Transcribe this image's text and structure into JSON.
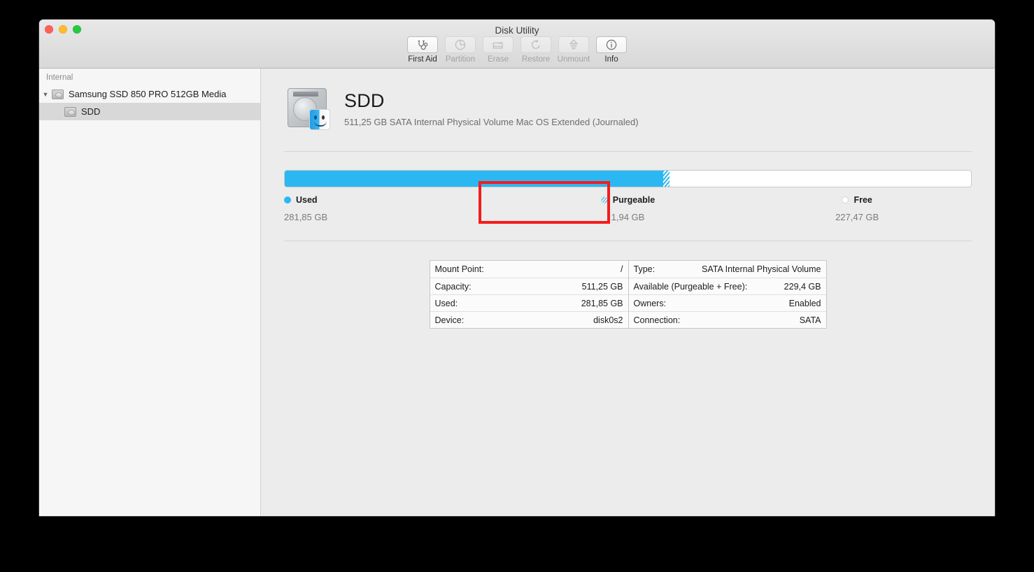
{
  "window": {
    "title": "Disk Utility",
    "traffic_lights": [
      "close",
      "minimize",
      "zoom"
    ]
  },
  "toolbar": {
    "items": [
      {
        "label": "First Aid",
        "icon": "stethoscope-icon",
        "enabled": true
      },
      {
        "label": "Partition",
        "icon": "pie-chart-icon",
        "enabled": false
      },
      {
        "label": "Erase",
        "icon": "erase-icon",
        "enabled": false
      },
      {
        "label": "Restore",
        "icon": "restore-arrow-icon",
        "enabled": false
      },
      {
        "label": "Unmount",
        "icon": "eject-icon",
        "enabled": false
      },
      {
        "label": "Info",
        "icon": "info-circle-icon",
        "enabled": true
      }
    ]
  },
  "sidebar": {
    "header": "Internal",
    "items": [
      {
        "label": "Samsung SSD 850 PRO 512GB Media",
        "level": 0,
        "expanded": true,
        "selected": false
      },
      {
        "label": "SDD",
        "level": 1,
        "expanded": false,
        "selected": true
      }
    ]
  },
  "volume": {
    "name": "SDD",
    "subtitle": "511,25 GB SATA Internal Physical Volume Mac OS Extended (Journaled)",
    "icon": "hard-disk-with-finder-face-icon"
  },
  "capacity_bar": {
    "used_percent": 55.1,
    "purgeable_percent": 1.0,
    "free_percent": 43.9,
    "used_color": "#2bb8f2",
    "free_color": "#ffffff",
    "purgeable_color": "#2bb8f2"
  },
  "legend": [
    {
      "name": "Used",
      "value": "281,85 GB",
      "swatch": "used"
    },
    {
      "name": "Purgeable",
      "value": "1,94 GB",
      "swatch": "purge"
    },
    {
      "name": "Free",
      "value": "227,47 GB",
      "swatch": "free"
    }
  ],
  "annotation": {
    "type": "red-rectangle-highlight",
    "color": "#f41c1c",
    "targets": "Purgeable legend entry"
  },
  "info_table": {
    "left": [
      {
        "label": "Mount Point:",
        "value": "/"
      },
      {
        "label": "Capacity:",
        "value": "511,25 GB"
      },
      {
        "label": "Used:",
        "value": "281,85 GB"
      },
      {
        "label": "Device:",
        "value": "disk0s2"
      }
    ],
    "right": [
      {
        "label": "Type:",
        "value": "SATA Internal Physical Volume"
      },
      {
        "label": "Available (Purgeable + Free):",
        "value": "229,4 GB"
      },
      {
        "label": "Owners:",
        "value": "Enabled"
      },
      {
        "label": "Connection:",
        "value": "SATA"
      }
    ]
  }
}
